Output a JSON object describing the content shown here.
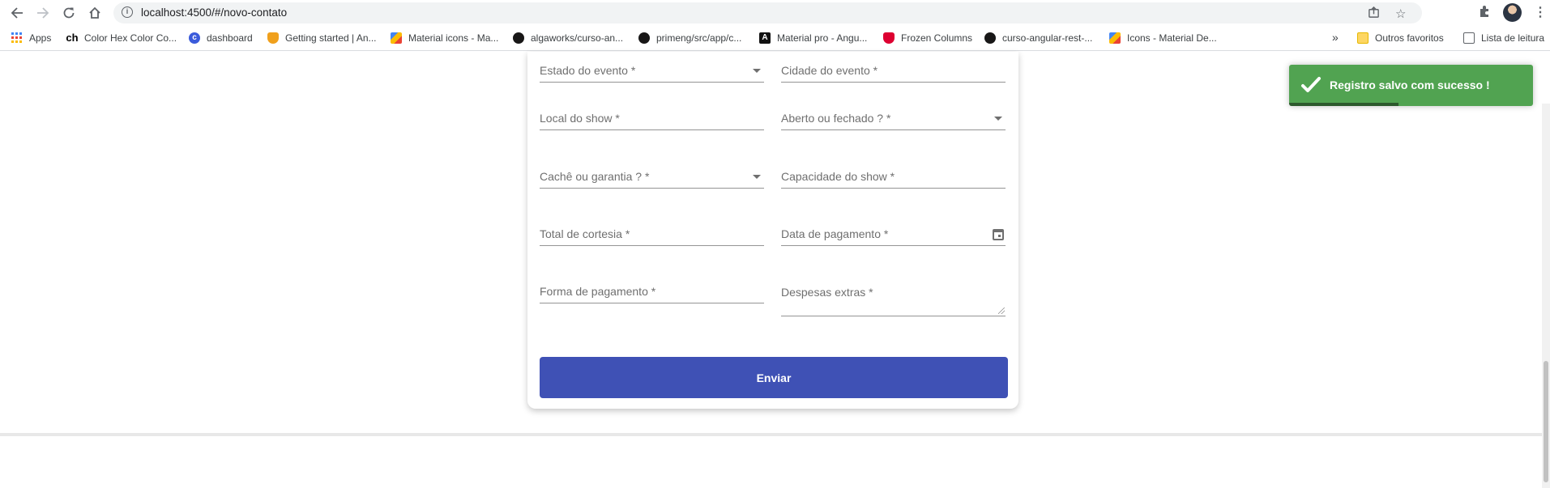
{
  "browser": {
    "url": "localhost:4500/#/novo-contato",
    "bookmarks": [
      {
        "label": "Apps",
        "icon": "apps-grid-icon",
        "color": "#4285f4"
      },
      {
        "label": "Color Hex Color Co...",
        "icon": "ch-icon",
        "color": "#000000"
      },
      {
        "label": "dashboard",
        "icon": "dashboard-icon",
        "color": "#3b5bdb"
      },
      {
        "label": "Getting started | An...",
        "icon": "shield-orange-icon",
        "color": "#f0a01c"
      },
      {
        "label": "Material icons - Ma...",
        "icon": "material-icons-icon",
        "color": "#e8710a"
      },
      {
        "label": "algaworks/curso-an...",
        "icon": "github-icon",
        "color": "#181717"
      },
      {
        "label": "primeng/src/app/c...",
        "icon": "github-icon",
        "color": "#181717"
      },
      {
        "label": "Material pro - Angu...",
        "icon": "angular-icon",
        "color": "#111111"
      },
      {
        "label": "Frozen Columns",
        "icon": "primeng-shield-icon",
        "color": "#dd0031"
      },
      {
        "label": "curso-angular-rest-...",
        "icon": "github-icon",
        "color": "#181717"
      },
      {
        "label": "Icons - Material De...",
        "icon": "material-design-icon",
        "color": "#e8710a"
      }
    ],
    "overflow_label": "»",
    "other_favorites": "Outros favoritos",
    "reading_list": "Lista de leitura"
  },
  "form": {
    "fields": {
      "estado": "Estado do evento *",
      "cidade": "Cidade do evento *",
      "local": "Local do show *",
      "aberto": "Aberto ou fechado ? *",
      "cache": "Cachê ou garantia ? *",
      "capacidade": "Capacidade do show *",
      "cortesia": "Total de cortesia *",
      "data_pagamento": "Data de pagamento *",
      "forma_pagamento": "Forma de pagamento *",
      "despesas": "Despesas extras *"
    },
    "submit_label": "Enviar",
    "accent_color": "#3f51b5"
  },
  "toast": {
    "message": "Registro salvo com sucesso !",
    "color": "#51a351",
    "progress": 0.45
  }
}
